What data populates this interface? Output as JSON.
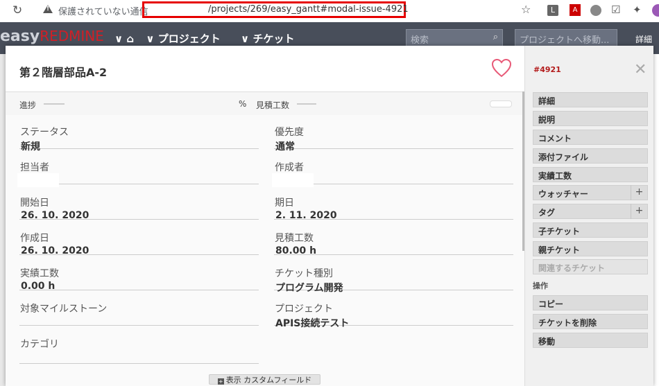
{
  "browser": {
    "insecure_label": "保護されていない通信",
    "url": "/projects/269/easy_gantt#modal-issue-4921"
  },
  "app": {
    "logo_easy": "easy",
    "logo_redmine": "REDMINE",
    "nav_projects": "プロジェクト",
    "nav_issues": "チケット",
    "search_placeholder": "検索",
    "jump_label": "プロジェクトへ移動...",
    "detail_label": "詳細"
  },
  "issue": {
    "title": "第２階層部品A-2",
    "id": "#4921",
    "progress_label": "進捗",
    "percent_sign": "%",
    "estimated_label": "見積工数",
    "fields": {
      "status": {
        "label": "ステータス",
        "value": "新規"
      },
      "priority": {
        "label": "優先度",
        "value": "通常"
      },
      "assignee": {
        "label": "担当者",
        "value": ""
      },
      "author": {
        "label": "作成者",
        "value": ""
      },
      "start_date": {
        "label": "開始日",
        "value": "26. 10. 2020"
      },
      "due_date": {
        "label": "期日",
        "value": "2. 11. 2020"
      },
      "created_on": {
        "label": "作成日",
        "value": "26. 10. 2020"
      },
      "estimated_hours": {
        "label": "見積工数",
        "value": "80.00 h"
      },
      "spent_time": {
        "label": "実績工数",
        "value": "0.00 h"
      },
      "tracker": {
        "label": "チケット種別",
        "value": "プログラム開発"
      },
      "version": {
        "label": "対象マイルストーン",
        "value": ""
      },
      "project": {
        "label": "プロジェクト",
        "value": "APIS接続テスト"
      },
      "category": {
        "label": "カテゴリ",
        "value": ""
      }
    },
    "custom_fields_button": "表示 カスタムフィールド"
  },
  "sidebar": {
    "items": [
      {
        "label": "詳細"
      },
      {
        "label": "説明"
      },
      {
        "label": "コメント"
      },
      {
        "label": "添付ファイル"
      },
      {
        "label": "実績工数"
      },
      {
        "label": "ウォッチャー",
        "add": "+"
      },
      {
        "label": "タグ",
        "add": "+"
      },
      {
        "label": "子チケット"
      },
      {
        "label": "親チケット"
      },
      {
        "label": "関連するチケット",
        "disabled": true
      }
    ],
    "ops_label": "操作",
    "ops": [
      {
        "label": "コピー"
      },
      {
        "label": "チケットを削除"
      },
      {
        "label": "移動"
      }
    ]
  },
  "colors": {
    "app_bar": "#484e5a",
    "issue_id": "#b31b1b",
    "favorite_heart": "#e85a78",
    "url_highlight": "#e60000"
  }
}
